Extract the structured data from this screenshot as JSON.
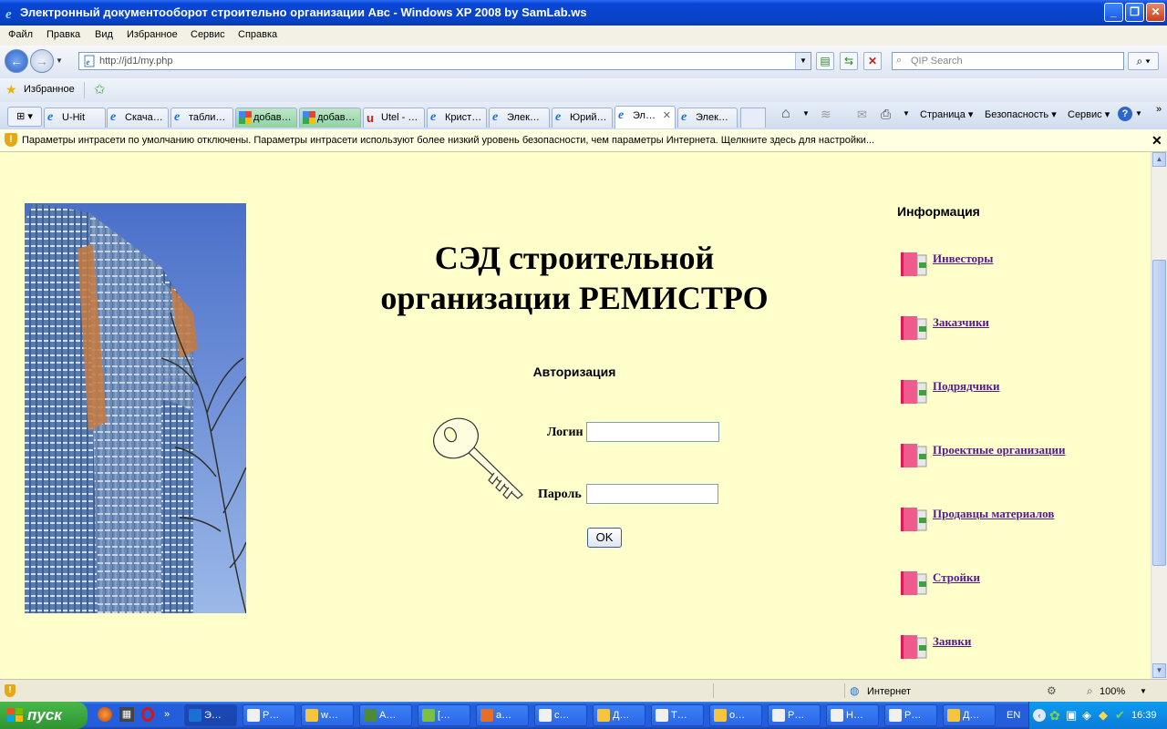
{
  "window": {
    "title": "Электронный документооборот строительно организации Авс - Windows XP 2008 by SamLab.ws"
  },
  "menu": [
    "Файл",
    "Правка",
    "Вид",
    "Избранное",
    "Сервис",
    "Справка"
  ],
  "address": {
    "url": "http://jd1/my.php"
  },
  "search": {
    "placeholder": "QIP Search"
  },
  "favorites": {
    "label": "Избранное"
  },
  "tabs": [
    {
      "label": "U-Hit",
      "style": "ie"
    },
    {
      "label": "Скача…",
      "style": "ie"
    },
    {
      "label": "табли…",
      "style": "ie"
    },
    {
      "label": "добав…",
      "style": "green"
    },
    {
      "label": "добав…",
      "style": "green"
    },
    {
      "label": "Utel - …",
      "style": "utel"
    },
    {
      "label": "Крист…",
      "style": "ie"
    },
    {
      "label": "Элек…",
      "style": "ie"
    },
    {
      "label": "Юрий…",
      "style": "ie"
    },
    {
      "label": "Эл…",
      "style": "active"
    },
    {
      "label": "Элек…",
      "style": "ie"
    }
  ],
  "commands": {
    "page": "Страница",
    "safety": "Безопасность",
    "tools": "Сервис"
  },
  "infobar": {
    "text": "Параметры интрасети по умолчанию отключены. Параметры интрасети используют более низкий уровень безопасности, чем параметры Интернета. Щелкните здесь для настройки..."
  },
  "page": {
    "title_line1": "СЭД строительной",
    "title_line2": "организации РЕМИСТРО",
    "auth_heading": "Авторизация",
    "login_label": "Логин",
    "password_label": "Пароль",
    "ok_label": "OK",
    "info_heading": "Информация",
    "nav": [
      "Инвесторы",
      "Заказчики",
      "Подрядчики",
      "Проектные организации",
      "Продавцы материалов",
      "Стройки",
      "Заявки"
    ]
  },
  "status": {
    "zone": "Интернет",
    "zoom": "100%"
  },
  "taskbar": {
    "start": "пуск",
    "items": [
      "Э…",
      "Р…",
      "w…",
      "A…",
      "[…",
      "a…",
      "c…",
      "Д…",
      "Т…",
      "o…",
      "Р…",
      "Н…",
      "Р…",
      "Д…"
    ],
    "lang": "EN",
    "clock": "16:39"
  },
  "colors": {
    "page_bg": "#ffffcc",
    "link": "#551a8b",
    "titlebar": "#0842c5",
    "taskbar": "#245edb"
  }
}
